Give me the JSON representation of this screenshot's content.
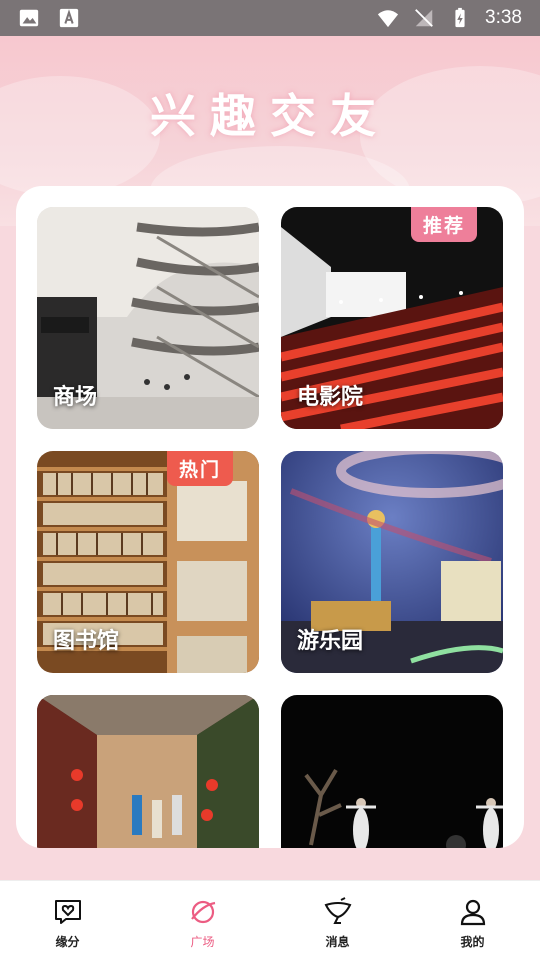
{
  "status_bar": {
    "time": "3:38"
  },
  "header": {
    "title": "兴趣交友"
  },
  "tiles": [
    {
      "label": "商场",
      "badge": ""
    },
    {
      "label": "电影院",
      "badge": "推荐"
    },
    {
      "label": "图书馆",
      "badge": "热门"
    },
    {
      "label": "游乐园",
      "badge": ""
    },
    {
      "label": "",
      "badge": ""
    },
    {
      "label": "",
      "badge": ""
    }
  ],
  "nav": [
    {
      "label": "缘分",
      "icon": "heart-chat-icon"
    },
    {
      "label": "广场",
      "icon": "planet-icon",
      "active": true
    },
    {
      "label": "消息",
      "icon": "message-icon"
    },
    {
      "label": "我的",
      "icon": "user-icon"
    }
  ],
  "colors": {
    "accent": "#ec5c82",
    "badge_pink": "#ee7f9a",
    "badge_red": "#ee5b4e"
  }
}
